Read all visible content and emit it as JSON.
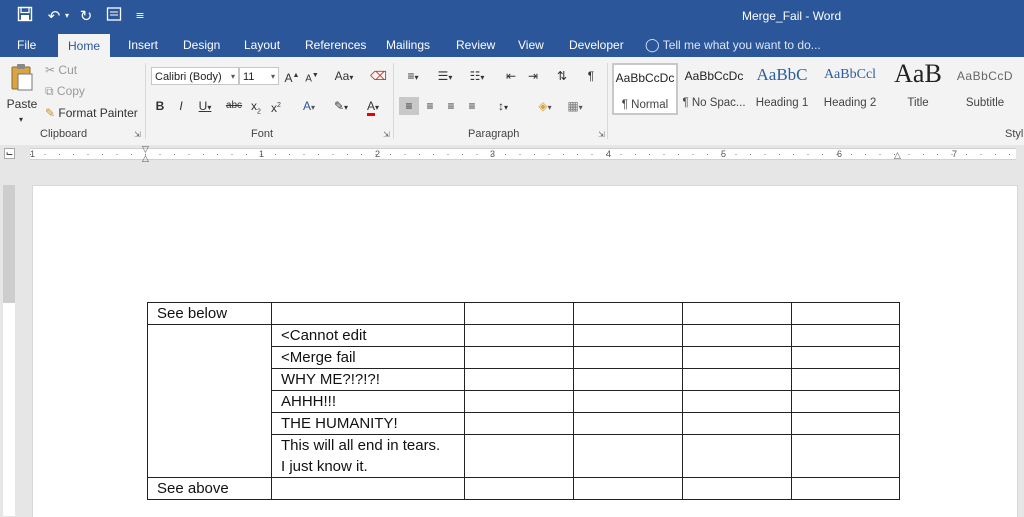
{
  "window": {
    "title": "Merge_Fail - Word",
    "accent": "#2b579a"
  },
  "qat": {
    "customize_glyph": "≡"
  },
  "tabs": [
    "File",
    "Home",
    "Insert",
    "Design",
    "Layout",
    "References",
    "Mailings",
    "Review",
    "View",
    "Developer"
  ],
  "active_tab": "Home",
  "tell_me": {
    "placeholder": "Tell me what you want to do..."
  },
  "ribbon": {
    "clipboard": {
      "label": "Clipboard",
      "paste": "Paste",
      "cut": "Cut",
      "copy": "Copy",
      "format_painter": "Format Painter"
    },
    "font": {
      "label": "Font",
      "family": "Calibri (Body)",
      "size": "11"
    },
    "paragraph": {
      "label": "Paragraph"
    },
    "styles": {
      "label": "Styl",
      "items": [
        {
          "preview": "AaBbCcDc",
          "name": "¶ Normal"
        },
        {
          "preview": "AaBbCcDc",
          "name": "¶ No Spac..."
        },
        {
          "preview": "AaBbC",
          "name": "Heading 1"
        },
        {
          "preview": "AaBbCcl",
          "name": "Heading 2"
        },
        {
          "preview": "AaB",
          "name": "Title"
        },
        {
          "preview": "AaBbCcD",
          "name": "Subtitle"
        }
      ]
    }
  },
  "ruler": {
    "numbers": [
      "1",
      "1",
      "2",
      "3",
      "4",
      "5",
      "6",
      "7"
    ]
  },
  "document": {
    "rows": [
      [
        "See below",
        "",
        "",
        "",
        "",
        ""
      ],
      [
        "",
        "<Cannot edit",
        "",
        "",
        "",
        ""
      ],
      [
        "",
        "<Merge fail",
        "",
        "",
        "",
        ""
      ],
      [
        "",
        "WHY ME?!?!?!",
        "",
        "",
        "",
        ""
      ],
      [
        "",
        "AHHH!!!",
        "",
        "",
        "",
        ""
      ],
      [
        "",
        "THE HUMANITY!",
        "",
        "",
        "",
        ""
      ],
      [
        "",
        "This will all end in tears.",
        "",
        "",
        "",
        ""
      ],
      [
        "",
        "I just know it.",
        "",
        "",
        "",
        ""
      ],
      [
        "See above",
        "",
        "",
        "",
        "",
        ""
      ]
    ]
  }
}
